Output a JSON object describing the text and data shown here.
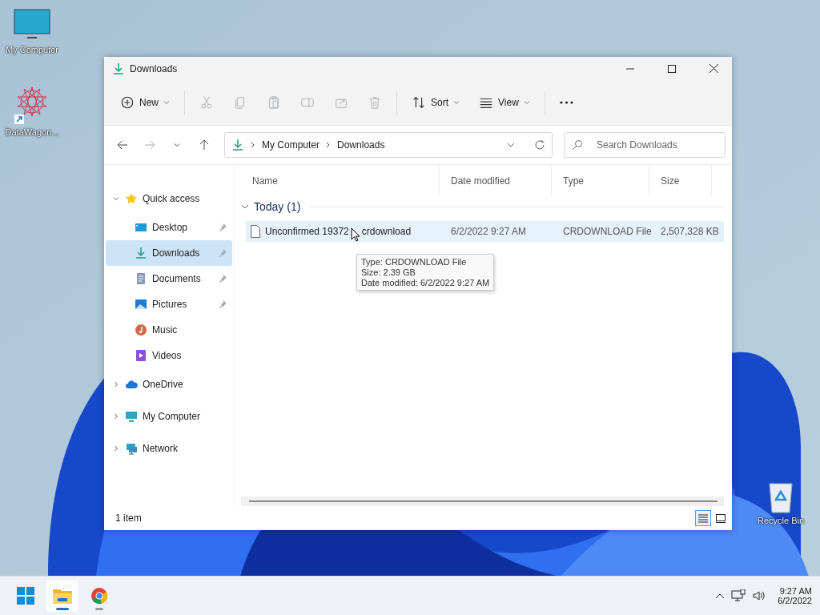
{
  "desktop_icons": [
    {
      "kind": "computer",
      "label": "My Computer"
    },
    {
      "kind": "app",
      "label": "DataWagon..."
    },
    {
      "kind": "recycle",
      "label": "Recycle Bin"
    }
  ],
  "window": {
    "title": "Downloads",
    "toolbar": [
      {
        "kind": "new",
        "label": "New",
        "disabled": false
      },
      {
        "kind": "cut",
        "disabled": true
      },
      {
        "kind": "copy",
        "disabled": true
      },
      {
        "kind": "paste",
        "disabled": true
      },
      {
        "kind": "rename",
        "disabled": true
      },
      {
        "kind": "share",
        "disabled": true
      },
      {
        "kind": "delete",
        "disabled": true
      },
      {
        "kind": "sort",
        "label": "Sort",
        "disabled": false
      },
      {
        "kind": "view",
        "label": "View",
        "disabled": false
      },
      {
        "kind": "more",
        "disabled": false
      }
    ],
    "address": {
      "segments": [
        "My Computer",
        "Downloads"
      ]
    },
    "search": {
      "placeholder": "Search Downloads"
    },
    "sidebar": [
      {
        "kind": "star",
        "label": "Quick access",
        "expanded": true,
        "selected": false,
        "children": [
          {
            "kind": "desktop",
            "label": "Desktop",
            "pinned": true,
            "selected": false
          },
          {
            "kind": "download",
            "label": "Downloads",
            "pinned": true,
            "selected": true
          },
          {
            "kind": "documents",
            "label": "Documents",
            "pinned": true,
            "selected": false
          },
          {
            "kind": "pictures",
            "label": "Pictures",
            "pinned": true,
            "selected": false
          },
          {
            "kind": "music",
            "label": "Music",
            "pinned": false,
            "selected": false
          },
          {
            "kind": "videos",
            "label": "Videos",
            "pinned": false,
            "selected": false
          }
        ]
      },
      {
        "kind": "cloud",
        "label": "OneDrive",
        "expanded": false,
        "selected": false
      },
      {
        "kind": "computer",
        "label": "My Computer",
        "expanded": false,
        "selected": false
      },
      {
        "kind": "network",
        "label": "Network",
        "expanded": false,
        "selected": false
      }
    ],
    "columns": [
      "Name",
      "Date modified",
      "Type",
      "Size"
    ],
    "groups": [
      {
        "label": "Today (1)",
        "expanded": true,
        "files": [
          {
            "name_parts": [
              "Unconfirmed 19372",
              "crdownload"
            ],
            "date": "6/2/2022 9:27 AM",
            "type": "CRDOWNLOAD File",
            "size": "2,507,328 KB",
            "selected": true
          }
        ]
      }
    ],
    "tooltip": [
      "Type: CRDOWNLOAD File",
      "Size: 2.39 GB",
      "Date modified: 6/2/2022 9:27 AM"
    ],
    "status": "1 item",
    "views": [
      {
        "kind": "details",
        "selected": true
      },
      {
        "kind": "tiles",
        "selected": false
      }
    ]
  },
  "taskbar": {
    "apps": [
      {
        "kind": "start",
        "active": false
      },
      {
        "kind": "explorer",
        "active": true
      },
      {
        "kind": "browser",
        "active": false
      }
    ],
    "time": "9:27 AM",
    "date": "6/2/2022"
  }
}
